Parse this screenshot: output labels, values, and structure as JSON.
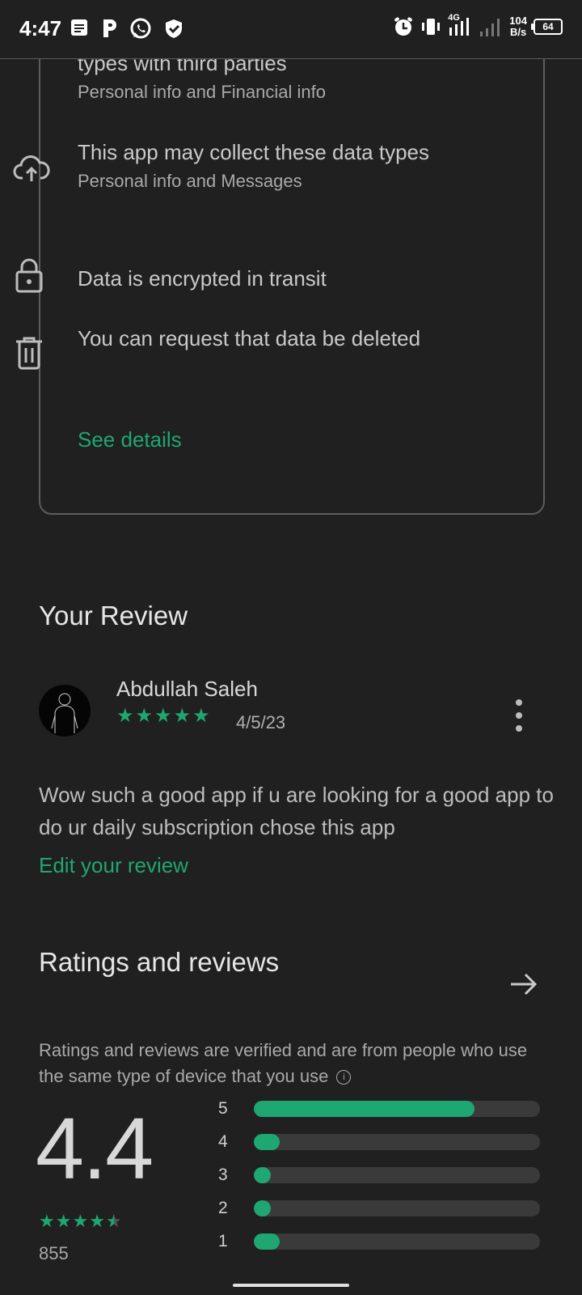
{
  "status_bar": {
    "time": "4:47",
    "network": "4G",
    "speed_value": "104",
    "speed_unit": "B/s",
    "battery": "64"
  },
  "data_safety": {
    "items": [
      {
        "title": "types with third parties",
        "subtitle": "Personal info and Financial info",
        "icon": "share-icon"
      },
      {
        "title": "This app may collect these data types",
        "subtitle": "Personal info and Messages",
        "icon": "cloud-upload-icon"
      },
      {
        "title": "Data is encrypted in transit",
        "subtitle": "",
        "icon": "lock-icon"
      },
      {
        "title": "You can request that data be deleted",
        "subtitle": "",
        "icon": "trash-icon"
      }
    ],
    "see_details": "See details"
  },
  "your_review": {
    "heading": "Your Review",
    "reviewer": "Abdullah Saleh",
    "stars": 5,
    "date": "4/5/23",
    "text": "Wow such a good app if u are looking for a good app to do ur daily subscription chose this app",
    "edit_link": "Edit your review"
  },
  "ratings": {
    "heading": "Ratings and reviews",
    "note": "Ratings and reviews are verified and are from people who use the same type of device that you use",
    "average": "4.4",
    "average_stars": 4.5,
    "count": "855",
    "bars": [
      {
        "label": "5",
        "fraction": 0.77
      },
      {
        "label": "4",
        "fraction": 0.09
      },
      {
        "label": "3",
        "fraction": 0.05
      },
      {
        "label": "2",
        "fraction": 0.05
      },
      {
        "label": "1",
        "fraction": 0.09
      }
    ]
  },
  "colors": {
    "accent": "#1ea772",
    "background": "#202020"
  }
}
